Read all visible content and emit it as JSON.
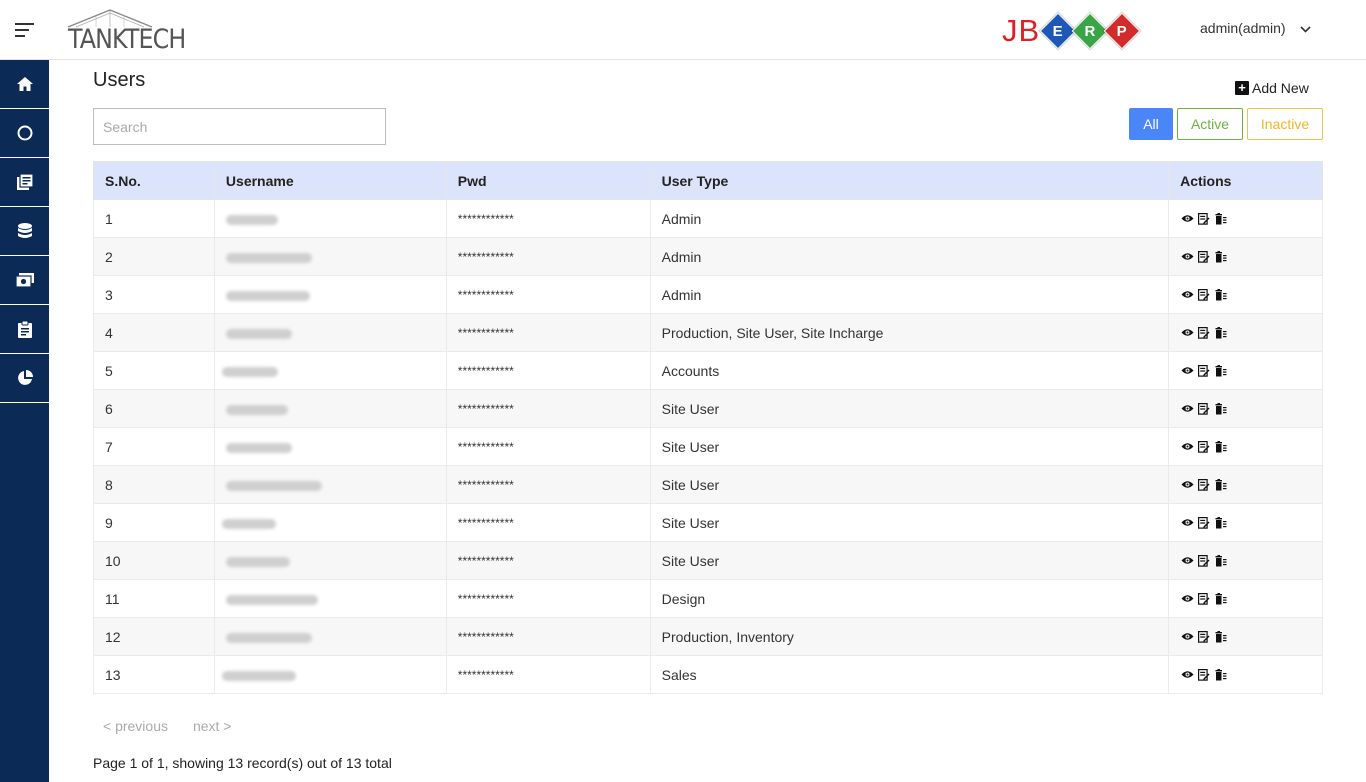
{
  "header": {
    "brand": "TANKTECH",
    "erp_logo": {
      "prefix": "JB",
      "letters": [
        {
          "char": "E",
          "color": "#1f57b5"
        },
        {
          "char": "R",
          "color": "#3aa547"
        },
        {
          "char": "P",
          "color": "#d22b2b"
        }
      ]
    },
    "user_label": "admin(admin)"
  },
  "sidebar": {
    "items": [
      {
        "icon": "home-icon"
      },
      {
        "icon": "circle-icon"
      },
      {
        "icon": "books-icon"
      },
      {
        "icon": "database-icon"
      },
      {
        "icon": "cash-icon"
      },
      {
        "icon": "clipboard-icon"
      },
      {
        "icon": "pie-chart-icon"
      }
    ],
    "background": "#0b2a55"
  },
  "page": {
    "title": "Users",
    "add_new_label": "Add New",
    "search_placeholder": "Search",
    "filters": {
      "all": "All",
      "active": "Active",
      "inactive": "Inactive"
    }
  },
  "table": {
    "columns": [
      "S.No.",
      "Username",
      "Pwd",
      "User Type",
      "Actions"
    ],
    "rows": [
      {
        "sno": "1",
        "pwd": "************",
        "type": "Admin"
      },
      {
        "sno": "2",
        "pwd": "************",
        "type": "Admin"
      },
      {
        "sno": "3",
        "pwd": "************",
        "type": "Admin"
      },
      {
        "sno": "4",
        "pwd": "************",
        "type": "Production, Site User, Site Incharge"
      },
      {
        "sno": "5",
        "pwd": "************",
        "type": "Accounts"
      },
      {
        "sno": "6",
        "pwd": "************",
        "type": "Site User"
      },
      {
        "sno": "7",
        "pwd": "************",
        "type": "Site User"
      },
      {
        "sno": "8",
        "pwd": "************",
        "type": "Site User"
      },
      {
        "sno": "9",
        "pwd": "************",
        "type": "Site User"
      },
      {
        "sno": "10",
        "pwd": "************",
        "type": "Site User"
      },
      {
        "sno": "11",
        "pwd": "************",
        "type": "Design"
      },
      {
        "sno": "12",
        "pwd": "************",
        "type": "Production, Inventory"
      },
      {
        "sno": "13",
        "pwd": "************",
        "type": "Sales"
      }
    ]
  },
  "pagination": {
    "previous": "< previous",
    "next": "next >",
    "summary": "Page 1 of 1, showing 13 record(s) out of 13 total"
  }
}
